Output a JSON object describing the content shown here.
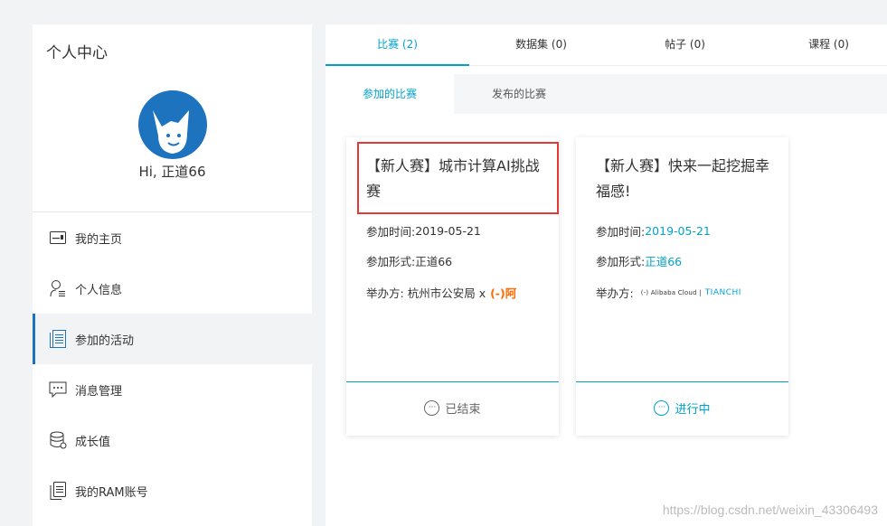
{
  "sidebar": {
    "title": "个人中心",
    "greeting": "Hi, 正道66",
    "items": [
      {
        "label": "我的主页",
        "icon": "id-card-icon"
      },
      {
        "label": "个人信息",
        "icon": "user-info-icon"
      },
      {
        "label": "参加的活动",
        "icon": "document-list-icon"
      },
      {
        "label": "消息管理",
        "icon": "message-icon"
      },
      {
        "label": "成长值",
        "icon": "database-icon"
      },
      {
        "label": "我的RAM账号",
        "icon": "file-copy-icon"
      }
    ],
    "active_index": 2
  },
  "main": {
    "tabs": [
      {
        "label": "比赛 (2)"
      },
      {
        "label": "数据集 (0)"
      },
      {
        "label": "帖子 (0)"
      },
      {
        "label": "课程 (0)"
      }
    ],
    "subtabs": [
      {
        "label": "参加的比赛"
      },
      {
        "label": "发布的比赛"
      }
    ],
    "cards": [
      {
        "title": "【新人赛】城市计算AI挑战赛",
        "time_label": "参加时间: ",
        "time_value": "2019-05-21",
        "form_label": "参加形式: ",
        "form_value": "正道66",
        "host_label": "举办方:",
        "host_value": "杭州市公安局 x",
        "host_logo_text": "(-)阿",
        "status": "已结束"
      },
      {
        "title": "【新人赛】快来一起挖掘幸福感!",
        "time_label": "参加时间: ",
        "time_value": "2019-05-21",
        "form_label": "参加形式: ",
        "form_value": "正道66",
        "host_label": "举办方:",
        "host_logo_text": "(-) Alibaba Cloud |",
        "host_logo_text2": "TIANCHI",
        "status": "进行中"
      }
    ]
  },
  "watermark": "https://blog.csdn.net/weixin_43306493",
  "colors": {
    "accent": "#00a2ca",
    "sidebar_active": "#1e73be",
    "highlight": "#e53935"
  }
}
